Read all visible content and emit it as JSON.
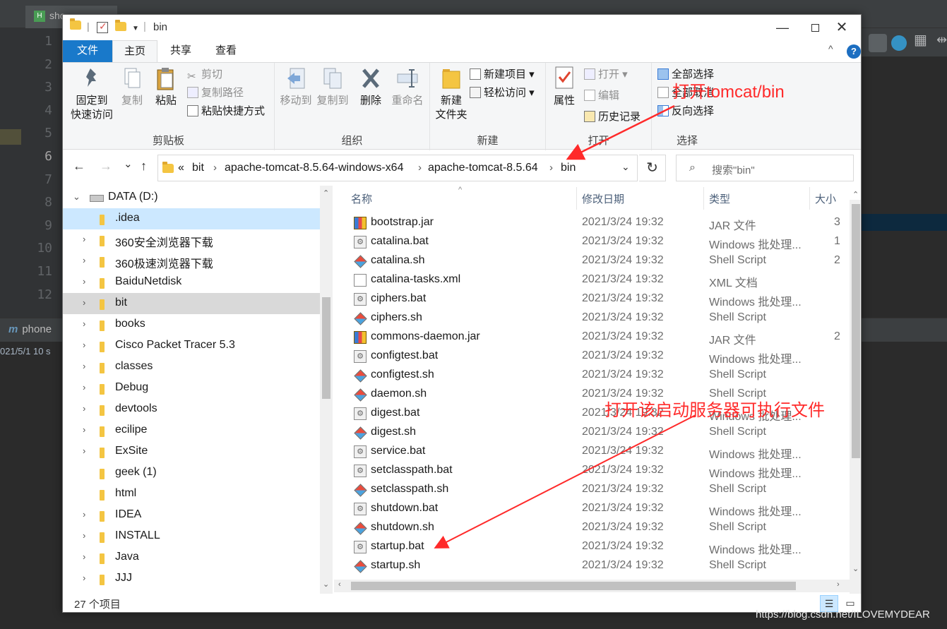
{
  "ide": {
    "tab1_label": "sho",
    "tab1_icon": "H",
    "line_numbers": [
      "1",
      "2",
      "3",
      "4",
      "5",
      "6",
      "7",
      "8",
      "9",
      "10",
      "11",
      "12"
    ],
    "active_line": "6",
    "run_name": "phone",
    "run_icon": "m",
    "run_time": "021/5/1 10 s"
  },
  "window": {
    "title": "bin",
    "controls": {
      "minimize": "—",
      "maximize": "",
      "close": "✕"
    }
  },
  "ribbon_tabs": {
    "file": "文件",
    "home": "主页",
    "share": "共享",
    "view": "查看",
    "collapse": "^",
    "help": "?"
  },
  "ribbon": {
    "clipboard": {
      "pin": "固定到\n快速访问",
      "pin_line1": "固定到",
      "pin_line2": "快速访问",
      "copy": "复制",
      "paste": "粘贴",
      "cut": "剪切",
      "copy_path": "复制路径",
      "paste_shortcut": "粘贴快捷方式",
      "label": "剪贴板"
    },
    "organize": {
      "move_to": "移动到",
      "copy_to": "复制到",
      "delete": "删除",
      "rename": "重命名",
      "label": "组织"
    },
    "new": {
      "new_folder_line1": "新建",
      "new_folder_line2": "文件夹",
      "new_item": "新建项目 ▾",
      "easy_access": "轻松访问 ▾",
      "label": "新建"
    },
    "open": {
      "properties": "属性",
      "open": "打开 ▾",
      "edit": "编辑",
      "history": "历史记录",
      "label": "打开"
    },
    "select": {
      "select_all": "全部选择",
      "select_none": "全部取消",
      "invert": "反向选择",
      "label": "选择"
    }
  },
  "address": {
    "back": "←",
    "forward": "→",
    "recent": "⌄",
    "up": "↑",
    "overflow": "«",
    "crumbs": [
      "bit",
      "apache-tomcat-8.5.64-windows-x64",
      "apache-tomcat-8.5.64",
      "bin"
    ],
    "separator": "›",
    "dropdown": "⌄",
    "refresh": "↻",
    "search_placeholder": "搜索\"bin\""
  },
  "nav_tree": {
    "root": "DATA (D:)",
    "items": [
      {
        "label": ".idea",
        "state": "selected",
        "expandable": false
      },
      {
        "label": "360安全浏览器下载",
        "state": "",
        "expandable": true
      },
      {
        "label": "360极速浏览器下载",
        "state": "",
        "expandable": true
      },
      {
        "label": "BaiduNetdisk",
        "state": "",
        "expandable": true
      },
      {
        "label": "bit",
        "state": "hover",
        "expandable": true
      },
      {
        "label": "books",
        "state": "",
        "expandable": true
      },
      {
        "label": "Cisco Packet Tracer 5.3",
        "state": "",
        "expandable": true
      },
      {
        "label": "classes",
        "state": "",
        "expandable": true
      },
      {
        "label": "Debug",
        "state": "",
        "expandable": true
      },
      {
        "label": "devtools",
        "state": "",
        "expandable": true
      },
      {
        "label": "ecilipe",
        "state": "",
        "expandable": true
      },
      {
        "label": "ExSite",
        "state": "",
        "expandable": true
      },
      {
        "label": "geek (1)",
        "state": "",
        "expandable": false
      },
      {
        "label": "html",
        "state": "",
        "expandable": false
      },
      {
        "label": "IDEA",
        "state": "",
        "expandable": true
      },
      {
        "label": "INSTALL",
        "state": "",
        "expandable": true
      },
      {
        "label": "Java",
        "state": "",
        "expandable": true
      },
      {
        "label": "JJJ",
        "state": "",
        "expandable": true
      }
    ]
  },
  "columns": {
    "name": "名称",
    "date": "修改日期",
    "type": "类型",
    "size": "大小"
  },
  "files": [
    {
      "name": "bootstrap.jar",
      "date": "2021/3/24 19:32",
      "type": "JAR 文件",
      "size": "3",
      "icon": "jar"
    },
    {
      "name": "catalina.bat",
      "date": "2021/3/24 19:32",
      "type": "Windows 批处理...",
      "size": "1",
      "icon": "bat"
    },
    {
      "name": "catalina.sh",
      "date": "2021/3/24 19:32",
      "type": "Shell Script",
      "size": "2",
      "icon": "sh"
    },
    {
      "name": "catalina-tasks.xml",
      "date": "2021/3/24 19:32",
      "type": "XML 文档",
      "size": "",
      "icon": "xml"
    },
    {
      "name": "ciphers.bat",
      "date": "2021/3/24 19:32",
      "type": "Windows 批处理...",
      "size": "",
      "icon": "bat"
    },
    {
      "name": "ciphers.sh",
      "date": "2021/3/24 19:32",
      "type": "Shell Script",
      "size": "",
      "icon": "sh"
    },
    {
      "name": "commons-daemon.jar",
      "date": "2021/3/24 19:32",
      "type": "JAR 文件",
      "size": "2",
      "icon": "jar"
    },
    {
      "name": "configtest.bat",
      "date": "2021/3/24 19:32",
      "type": "Windows 批处理...",
      "size": "",
      "icon": "bat"
    },
    {
      "name": "configtest.sh",
      "date": "2021/3/24 19:32",
      "type": "Shell Script",
      "size": "",
      "icon": "sh"
    },
    {
      "name": "daemon.sh",
      "date": "2021/3/24 19:32",
      "type": "Shell Script",
      "size": "",
      "icon": "sh"
    },
    {
      "name": "digest.bat",
      "date": "2021/3/24 19:32",
      "type": "Windows 批处理...",
      "size": "",
      "icon": "bat"
    },
    {
      "name": "digest.sh",
      "date": "2021/3/24 19:32",
      "type": "Shell Script",
      "size": "",
      "icon": "sh"
    },
    {
      "name": "service.bat",
      "date": "2021/3/24 19:32",
      "type": "Windows 批处理...",
      "size": "",
      "icon": "bat"
    },
    {
      "name": "setclasspath.bat",
      "date": "2021/3/24 19:32",
      "type": "Windows 批处理...",
      "size": "",
      "icon": "bat"
    },
    {
      "name": "setclasspath.sh",
      "date": "2021/3/24 19:32",
      "type": "Shell Script",
      "size": "",
      "icon": "sh"
    },
    {
      "name": "shutdown.bat",
      "date": "2021/3/24 19:32",
      "type": "Windows 批处理...",
      "size": "",
      "icon": "bat"
    },
    {
      "name": "shutdown.sh",
      "date": "2021/3/24 19:32",
      "type": "Shell Script",
      "size": "",
      "icon": "sh"
    },
    {
      "name": "startup.bat",
      "date": "2021/3/24 19:32",
      "type": "Windows 批处理...",
      "size": "",
      "icon": "bat"
    },
    {
      "name": "startup.sh",
      "date": "2021/3/24 19:32",
      "type": "Shell Script",
      "size": "",
      "icon": "sh"
    }
  ],
  "status": {
    "item_count": "27 个项目"
  },
  "annotations": {
    "open_bin": "打开tomcat/bin",
    "open_startup": "打开该启动服务器可执行文件",
    "color": "#ff2a2a"
  },
  "watermark": "https://blog.csdn.net/ILOVEMYDEAR",
  "colors": {
    "accent": "#1979ca",
    "selection": "#cce8ff",
    "ide_bg": "#2b2b2b"
  }
}
